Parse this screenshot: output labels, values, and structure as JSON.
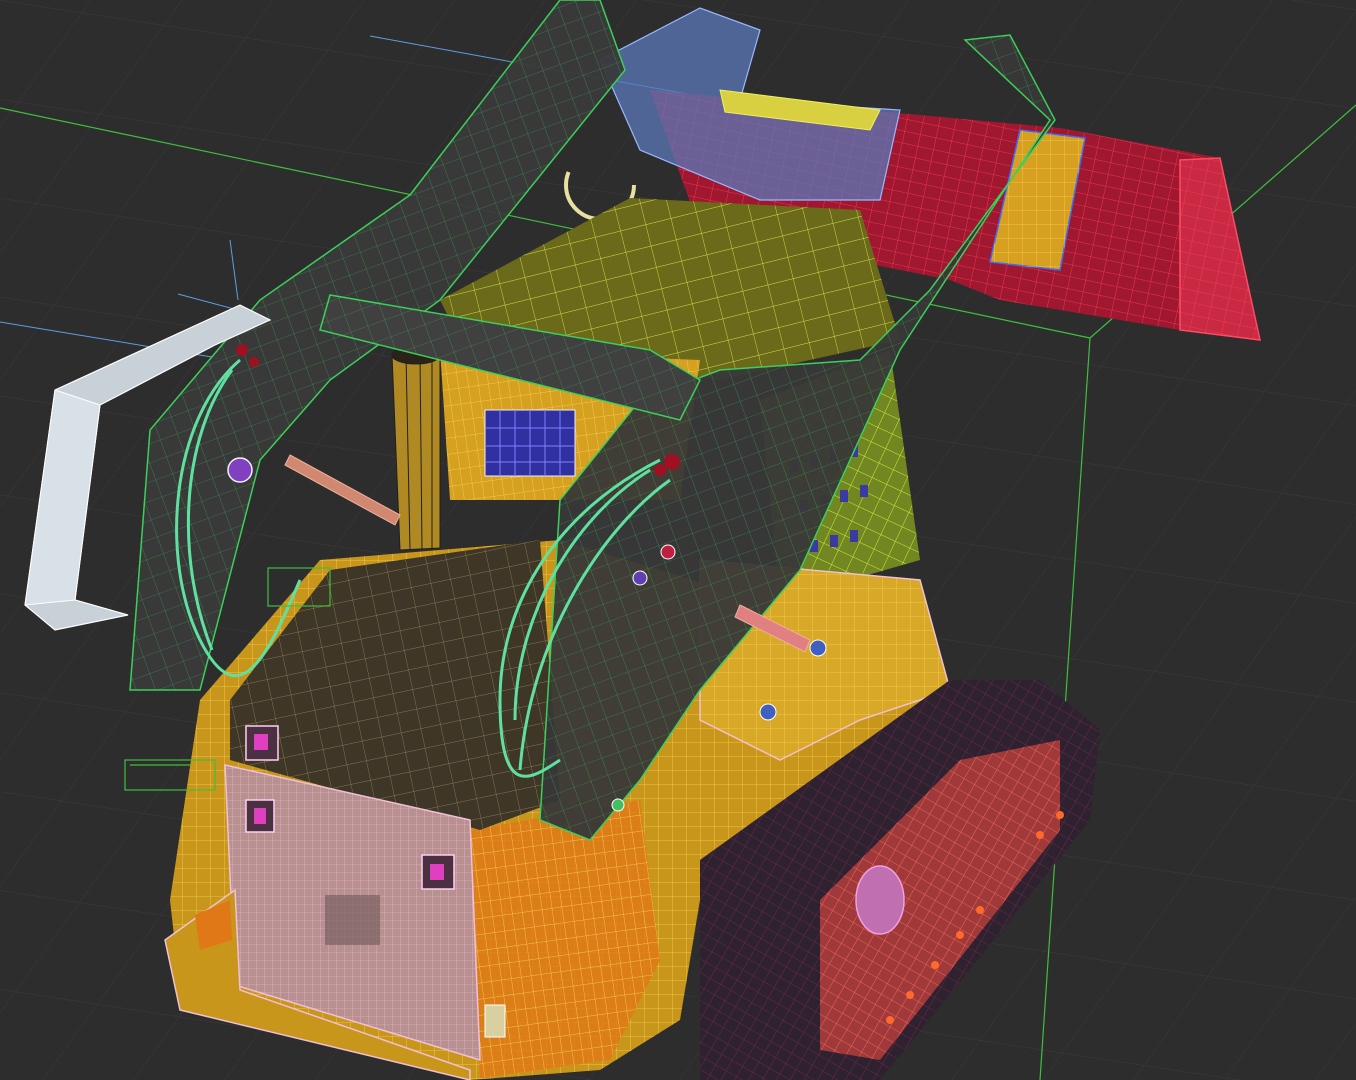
{
  "viewport": {
    "background": "#2d2d2d",
    "grid_color": "#3a3a3a",
    "axis_x_color": "#3fbf3f",
    "light_helper_color": "#5aa0e0",
    "display_mode": "wireframe-over-shaded"
  },
  "scene": {
    "object": "compact-track-loader",
    "parts": [
      {
        "name": "lift-arms",
        "color": "#3a4a3a",
        "wire": "#3ccf5a"
      },
      {
        "name": "bucket",
        "color": "#c72a3c",
        "wire": "#ff3a5a"
      },
      {
        "name": "cab-roof",
        "color": "#8a8a2a",
        "wire": "#d8e04a"
      },
      {
        "name": "body",
        "color": "#d4a020",
        "wire": "#f0c040"
      },
      {
        "name": "rear-grille",
        "color": "#c8a0a0",
        "wire": "#f0c0d0"
      },
      {
        "name": "engine-cover",
        "color": "#4a4030",
        "wire": "#b09060"
      },
      {
        "name": "exhaust-pipe",
        "color": "#b08a20",
        "wire": "#202020"
      },
      {
        "name": "track",
        "color": "#3a2a3a",
        "wire": "#702040"
      },
      {
        "name": "track-rollers",
        "color": "#c05050",
        "wire": "#ff6a5a"
      },
      {
        "name": "hydraulic-hoses",
        "color": "#3aa070",
        "wire": "#60e0a0"
      },
      {
        "name": "cab-cage",
        "color": "#a8c030",
        "wire": "#c8f040"
      },
      {
        "name": "cab-interior",
        "color": "#6a8ac8",
        "wire": "#9ab8ff"
      },
      {
        "name": "helper-light",
        "color": "#d0d8e0",
        "wire": "#ffffff"
      }
    ]
  }
}
